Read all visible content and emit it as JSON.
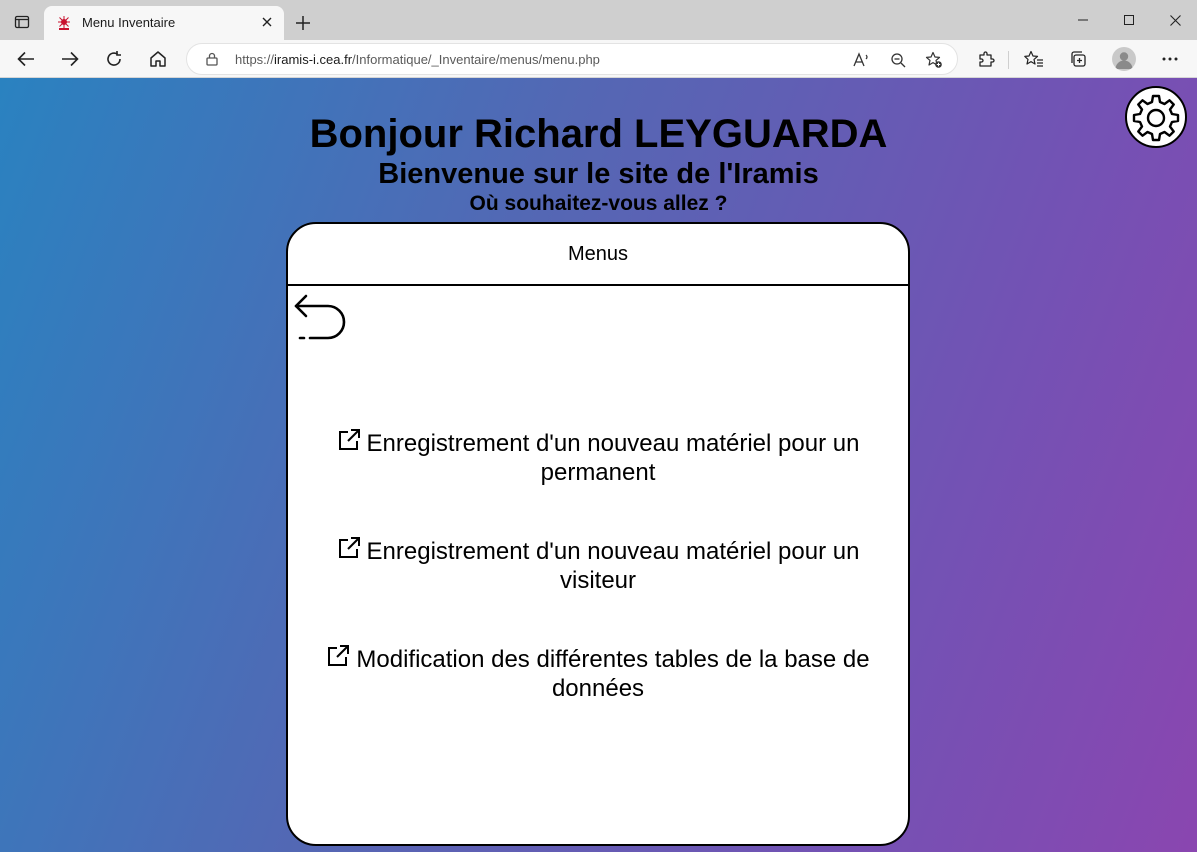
{
  "browser": {
    "tab_title": "Menu Inventaire",
    "url_prefix": "https://",
    "url_host": "iramis-i.cea.fr",
    "url_path": "/Informatique/_Inventaire/menus/menu.php"
  },
  "page": {
    "greeting": "Bonjour Richard LEYGUARDA",
    "welcome": "Bienvenue sur le site de l'Iramis",
    "question": "Où souhaitez-vous allez ?",
    "card_title": "Menus",
    "links": [
      "Enregistrement d'un nouveau matériel pour un permanent",
      "Enregistrement d'un nouveau matériel pour un visiteur",
      "Modification des différentes tables de la base de données"
    ]
  },
  "colors": {
    "gradient_start": "#2a82c0",
    "gradient_end": "#8a46b0"
  }
}
